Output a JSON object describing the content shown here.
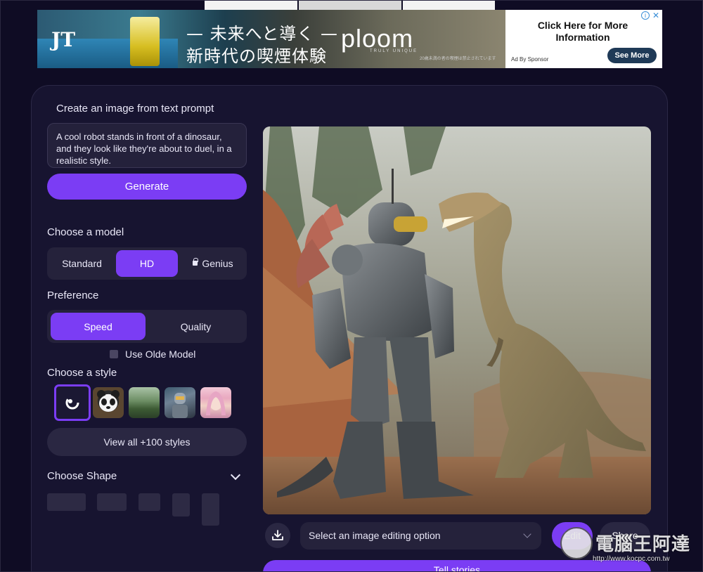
{
  "ad": {
    "logo": "JT",
    "headline_1": "— 未来へと導く —",
    "headline_2": "新時代の喫煙体験",
    "brand": "ploom",
    "brand_sub": "TRULY UNIQUE",
    "fine_print": "20歳未満の者の喫煙は禁止されています",
    "cta": "Click Here for More Information",
    "sponsor": "Ad By Sponsor",
    "see_more": "See More",
    "info_icon": "i",
    "close_icon": "✕"
  },
  "sidebar": {
    "heading": "Create an image from text prompt",
    "prompt_value": "A cool robot stands in front of a dinosaur, and they look like they're about to duel, in a realistic style.",
    "generate_label": "Generate",
    "model_label": "Choose a model",
    "models": [
      "Standard",
      "HD",
      "Genius"
    ],
    "model_selected": "HD",
    "preference_label": "Preference",
    "preferences": [
      "Speed",
      "Quality"
    ],
    "preference_selected": "Speed",
    "old_model_label": "Use Olde Model",
    "old_model_checked": false,
    "style_label": "Choose a style",
    "styles": [
      "none-style",
      "panda-style",
      "landscape-style",
      "robot-style",
      "portrait-style"
    ],
    "view_all_label": "View all +100 styles",
    "shape_label": "Choose Shape"
  },
  "main": {
    "image_alt": "robot-and-dinosaur-image",
    "edit_select_placeholder": "Select an image editing option",
    "edit_label": "Edit",
    "share_label": "Share",
    "tell_label": "Tell stories"
  },
  "watermark": {
    "text": "電腦王阿達",
    "url": "http://www.kocpc.com.tw"
  },
  "colors": {
    "background": "#0f0c24",
    "panel": "#171430",
    "accent": "#7b3df4",
    "control": "#25223b"
  }
}
